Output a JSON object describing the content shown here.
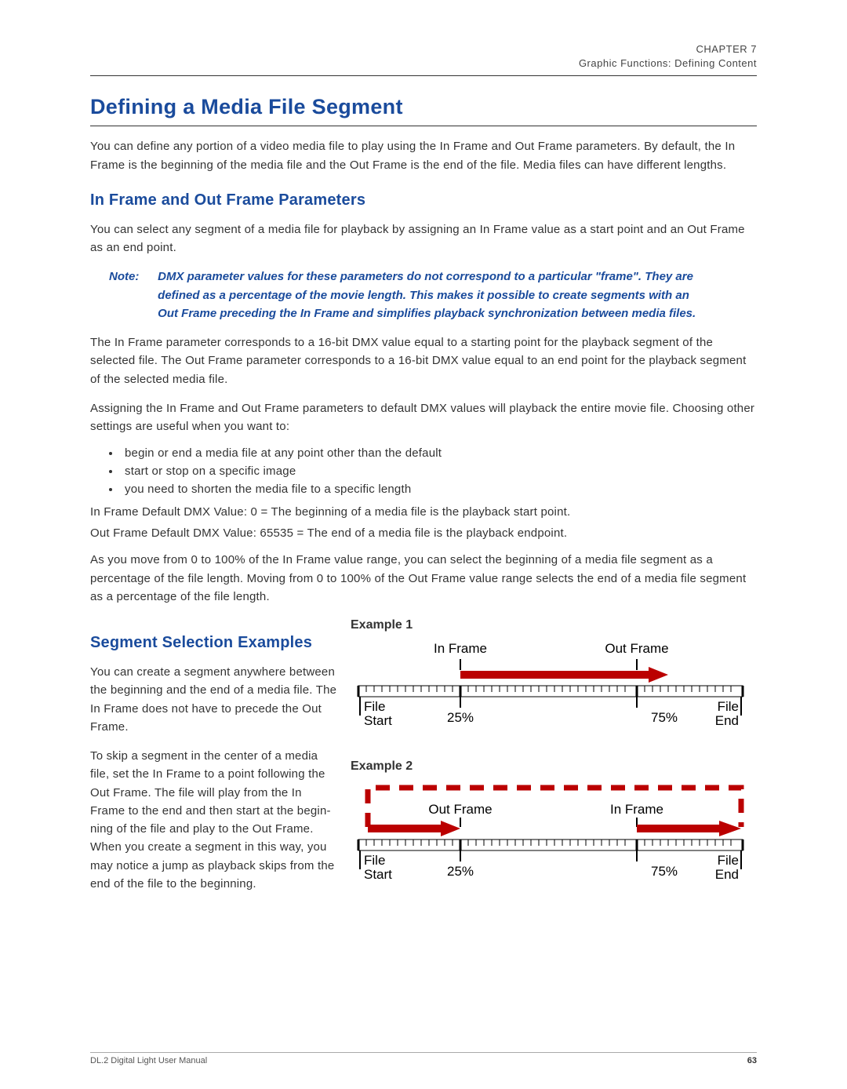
{
  "header": {
    "chapter": "CHAPTER 7",
    "section": "Graphic Functions: Defining Content"
  },
  "title": "Defining a Media File Segment",
  "intro": "You can define any portion of a video media file to play using the In Frame and Out Frame parameters. By default, the In Frame is the beginning of the media file and the Out Frame is the end of the file. Media files can have different lengths.",
  "sec1": {
    "heading": "In Frame and Out Frame Parameters",
    "p1": "You can select any segment of a media file for playback by assigning an In Frame value as a start point and an Out Frame as an end point.",
    "note_label": "Note:",
    "note_body": "DMX parameter values for these parameters do not correspond to a particular \"frame\". They are defined as a percentage of the movie length. This makes it possible to create segments with an Out Frame preceding the In Frame and simplifies playback synchronization between media files.",
    "p2": "The In Frame parameter corresponds to a 16-bit DMX value equal to a starting point for the playback segment of the selected file. The Out Frame parameter corresponds to a 16-bit DMX value equal to an end point for the playback segment of the selected media file.",
    "p3": "Assigning the In Frame and Out Frame parameters to default DMX values will playback the entire movie file. Choosing other settings are useful when you want to:",
    "bullets": [
      "begin or end a media file at any point other than the default",
      "start or stop on a specific image",
      "you need to shorten the media file to a specific length"
    ],
    "def_in": "In Frame Default DMX Value: 0 = The beginning of a media file is the playback start point.",
    "def_out": "Out Frame Default DMX Value: 65535 = The end of a media file is the playback endpoint.",
    "p4": "As you move from 0 to 100% of the In Frame value range, you can select the beginning of a media file segment as a percentage of the file length. Moving from 0 to 100% of the Out Frame value range selects the end of a media file segment as a percentage of the file length."
  },
  "sec2": {
    "heading": "Segment Selection Examples",
    "p1": "You can create a segment anywhere between the beginning and the end of a media file. The In Frame does not have to precede the Out Frame.",
    "p2": "To skip a segment in the center of a media file, set the In Frame to a point following the Out Frame. The file will play from the In Frame to the end and then start at the begin­ning of the file and play to the Out Frame. When you create a segment in this way, you may notice a jump as playback skips from the end of the file to the beginning."
  },
  "examples": {
    "e1": {
      "title": "Example 1",
      "in_label": "In Frame",
      "out_label": "Out Frame",
      "file_start": "File\nStart",
      "file_end": "File\nEnd",
      "pct_lo": "25%",
      "pct_hi": "75%"
    },
    "e2": {
      "title": "Example 2",
      "in_label": "In Frame",
      "out_label": "Out Frame",
      "file_start": "File\nStart",
      "file_end": "File\nEnd",
      "pct_lo": "25%",
      "pct_hi": "75%"
    }
  },
  "footer": {
    "left": "DL.2 Digital Light User Manual",
    "page": "63"
  }
}
